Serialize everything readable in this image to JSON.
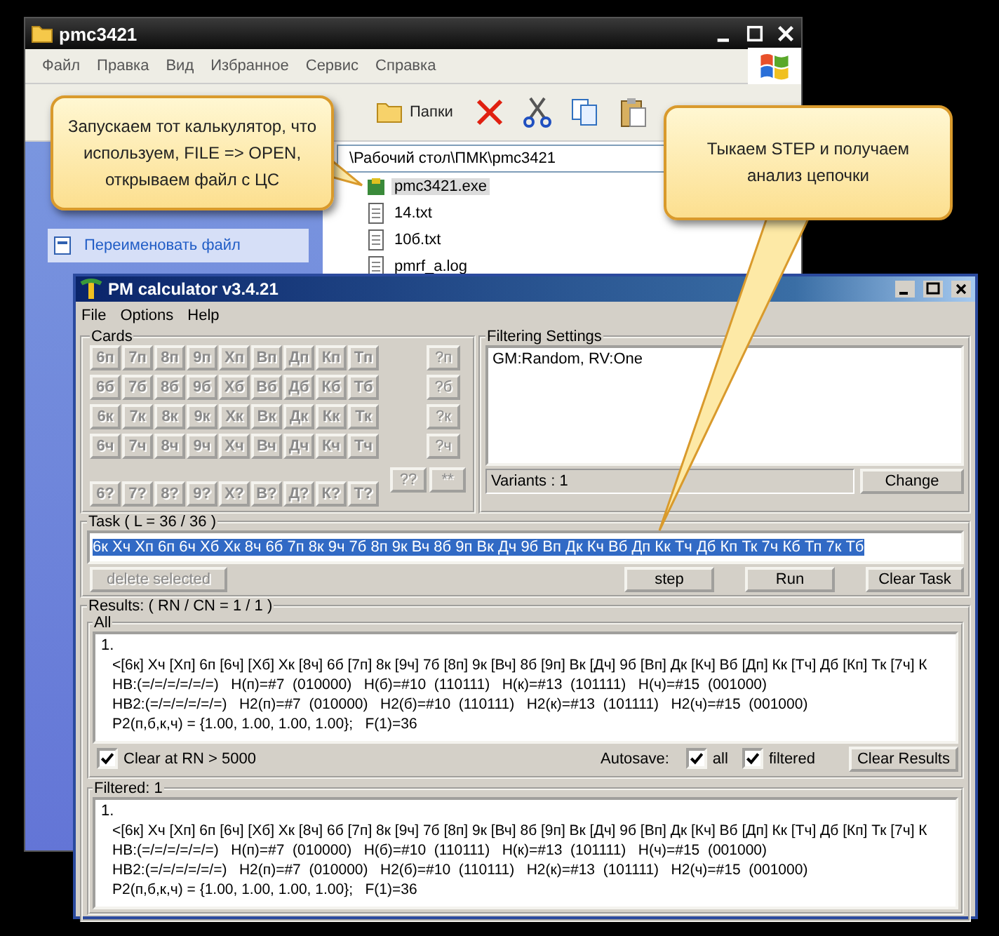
{
  "explorer": {
    "title": "pmc3421",
    "menu": [
      "Файл",
      "Правка",
      "Вид",
      "Избранное",
      "Сервис",
      "Справка"
    ],
    "toolbar": {
      "folders_label": "Папки"
    },
    "address": "\\Рабочий стол\\ПМК\\pmc3421",
    "tasks": [
      "Переименовать файл"
    ],
    "files": [
      {
        "name": "pmc3421.exe",
        "kind": "exe",
        "selected": true
      },
      {
        "name": "14.txt",
        "kind": "text",
        "selected": false
      },
      {
        "name": "10б.txt",
        "kind": "text",
        "selected": false
      },
      {
        "name": "pmrf_a.log",
        "kind": "text",
        "selected": false
      }
    ]
  },
  "calculator": {
    "title": "PM calculator v3.4.21",
    "menu": [
      "File",
      "Options",
      "Help"
    ],
    "cards": {
      "label": "Cards",
      "rows": [
        [
          {
            "label": "6п",
            "disabled": true
          },
          {
            "label": "7п",
            "disabled": true
          },
          {
            "label": "8п",
            "disabled": true
          },
          {
            "label": "9п",
            "disabled": true
          },
          {
            "label": "Хп",
            "disabled": true
          },
          {
            "label": "Вп",
            "disabled": true
          },
          {
            "label": "Дп",
            "disabled": true
          },
          {
            "label": "Кп",
            "disabled": true
          },
          {
            "label": "Тп",
            "disabled": true
          }
        ],
        [
          {
            "label": "6б",
            "disabled": true
          },
          {
            "label": "7б",
            "disabled": true
          },
          {
            "label": "8б",
            "disabled": true
          },
          {
            "label": "9б",
            "disabled": true
          },
          {
            "label": "Хб",
            "disabled": true
          },
          {
            "label": "Вб",
            "disabled": true
          },
          {
            "label": "Дб",
            "disabled": true
          },
          {
            "label": "Кб",
            "disabled": true
          },
          {
            "label": "Тб",
            "disabled": true
          }
        ],
        [
          {
            "label": "6к",
            "disabled": true
          },
          {
            "label": "7к",
            "disabled": true
          },
          {
            "label": "8к",
            "disabled": true
          },
          {
            "label": "9к",
            "disabled": true
          },
          {
            "label": "Хк",
            "disabled": true
          },
          {
            "label": "Вк",
            "disabled": true
          },
          {
            "label": "Дк",
            "disabled": true
          },
          {
            "label": "Кк",
            "disabled": true
          },
          {
            "label": "Тк",
            "disabled": true
          }
        ],
        [
          {
            "label": "6ч",
            "disabled": true
          },
          {
            "label": "7ч",
            "disabled": true
          },
          {
            "label": "8ч",
            "disabled": true
          },
          {
            "label": "9ч",
            "disabled": true
          },
          {
            "label": "Хч",
            "disabled": true
          },
          {
            "label": "Вч",
            "disabled": true
          },
          {
            "label": "Дч",
            "disabled": true
          },
          {
            "label": "Кч",
            "disabled": true
          },
          {
            "label": "Тч",
            "disabled": true
          }
        ]
      ],
      "suit_wildcards": [
        {
          "label": "?п",
          "disabled": true
        },
        {
          "label": "?б",
          "disabled": true
        },
        {
          "label": "?к",
          "disabled": true
        },
        {
          "label": "?ч",
          "disabled": true
        }
      ],
      "rank_wildcards": [
        {
          "label": "6?",
          "disabled": true
        },
        {
          "label": "7?",
          "disabled": true
        },
        {
          "label": "8?",
          "disabled": true
        },
        {
          "label": "9?",
          "disabled": true
        },
        {
          "label": "Х?",
          "disabled": true
        },
        {
          "label": "В?",
          "disabled": true
        },
        {
          "label": "Д?",
          "disabled": true
        },
        {
          "label": "К?",
          "disabled": true
        },
        {
          "label": "Т?",
          "disabled": true
        }
      ],
      "extra": [
        {
          "label": "??",
          "disabled": true
        },
        {
          "label": "**",
          "disabled": true
        }
      ]
    },
    "filtering": {
      "label": "Filtering Settings",
      "text": "GM:Random, RV:One",
      "variants": "Variants : 1",
      "button": "Change"
    },
    "task": {
      "label": "Task ( L = 36 / 36 )",
      "value": "6к Хч Хп 6п 6ч Хб Хк 8ч 6б 7п 8к 9ч 7б 8п 9к Вч 8б 9п Вк Дч 9б Вп Дк Кч Вб Дп Кк Тч Дб Кп Тк 7ч Кб Тп 7к Тб",
      "selected": true,
      "buttons": [
        {
          "label": "delete selected",
          "kind": "left",
          "disabled": true
        },
        {
          "label": "step",
          "kind": "right",
          "disabled": false
        },
        {
          "label": "Run",
          "kind": "right",
          "disabled": false
        },
        {
          "label": "Clear Task",
          "kind": "right",
          "disabled": false
        }
      ]
    },
    "results": {
      "label": "Results: ( RN / CN = 1 / 1 )",
      "all": {
        "label": "All",
        "lines": [
          "1.",
          "<[6к] Хч [Хп] 6п [6ч] [Хб] Хк [8ч] 6б [7п] 8к [9ч] 7б [8п] 9к [Вч] 8б [9п] Вк [Дч] 9б [Вп] Дк [Кч] Вб [Дп] Кк [Тч] Дб [Кп] Тк [7ч] К",
          "HB:(=/=/=/=/=/=)   H(п)=#7  (010000)   H(б)=#10  (110111)   H(к)=#13  (101111)   H(ч)=#15  (001000)",
          "HB2:(=/=/=/=/=/=)   H2(п)=#7  (010000)   H2(б)=#10  (110111)   H2(к)=#13  (101111)   H2(ч)=#15  (001000)",
          "P2(п,б,к,ч) = {1.00, 1.00, 1.00, 1.00};   F(1)=36"
        ]
      },
      "clear_at": {
        "label": "Clear at RN > 5000",
        "checked": true
      },
      "autosave_label": "Autosave:",
      "autosave": [
        {
          "label": "all",
          "checked": true
        },
        {
          "label": "filtered",
          "checked": true
        }
      ],
      "clear_button": "Clear Results",
      "filtered": {
        "label": "Filtered: 1",
        "lines": [
          "1.",
          "<[6к] Хч [Хп] 6п [6ч] [Хб] Хк [8ч] 6б [7п] 8к [9ч] 7б [8п] 9к [Вч] 8б [9п] Вк [Дч] 9б [Вп] Дк [Кч] Вб [Дп] Кк [Тч] Дб [Кп] Тк [7ч] К",
          "HB:(=/=/=/=/=/=)   H(п)=#7  (010000)   H(б)=#10  (110111)   H(к)=#13  (101111)   H(ч)=#15  (001000)",
          "HB2:(=/=/=/=/=/=)   H2(п)=#7  (010000)   H2(б)=#10  (110111)   H2(к)=#13  (101111)   H2(ч)=#15  (001000)",
          "P2(п,б,к,ч) = {1.00, 1.00, 1.00, 1.00};   F(1)=36"
        ]
      }
    }
  },
  "callouts": [
    {
      "text": "Запускаем тот калькулятор, что используем, FILE => OPEN, открываем файл с ЦС",
      "kind": "left"
    },
    {
      "text": "Тыкаем STEP и получаем анализ цепочки",
      "kind": "right"
    }
  ]
}
